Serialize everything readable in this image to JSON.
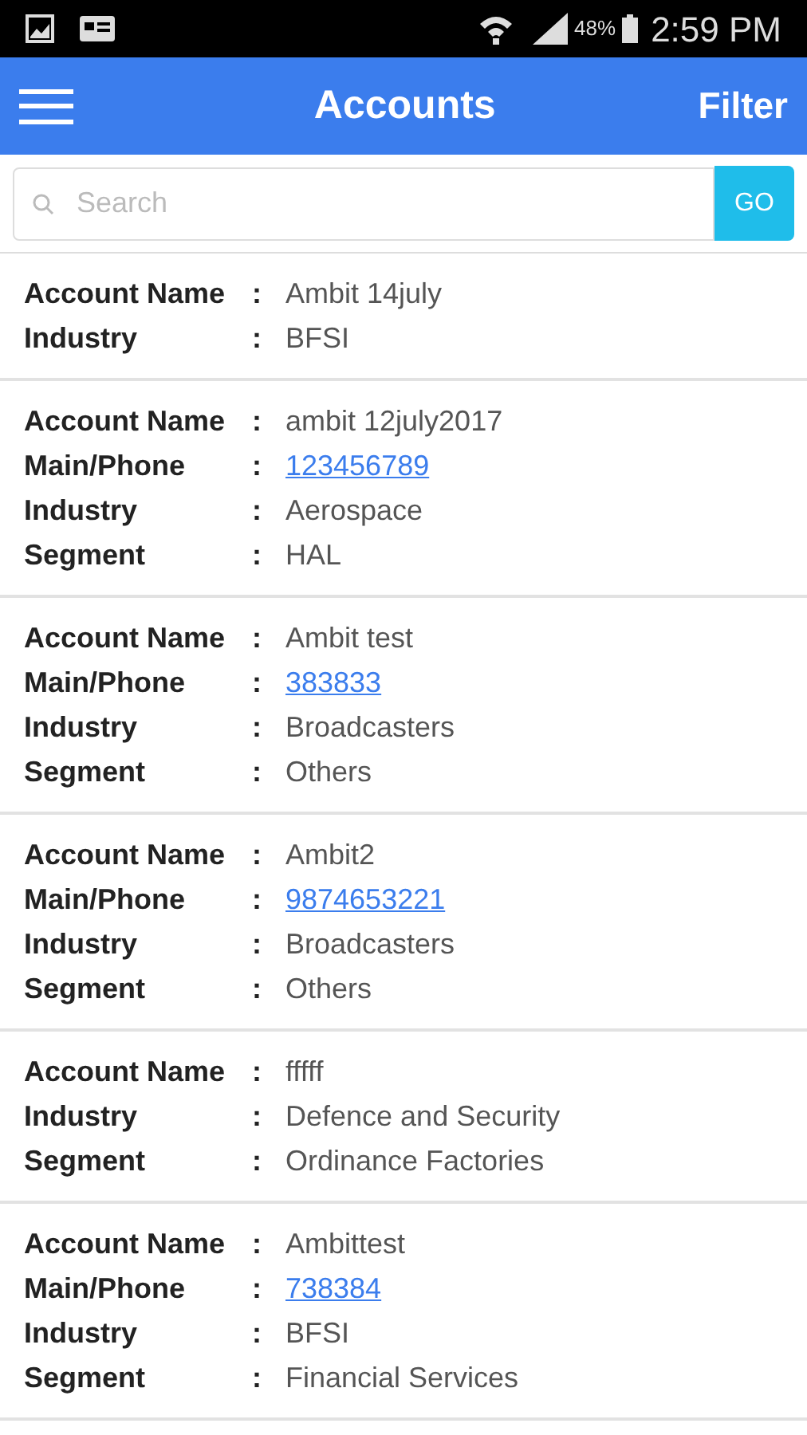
{
  "status_bar": {
    "battery": "48%",
    "time": "2:59 PM"
  },
  "header": {
    "title": "Accounts",
    "action": "Filter"
  },
  "search": {
    "placeholder": "Search",
    "button": "GO"
  },
  "accounts": [
    {
      "fields": [
        {
          "label": "Account Name",
          "separator": ":",
          "value": "Ambit 14july",
          "kind": "text"
        },
        {
          "label": "Industry",
          "separator": ":",
          "value": "BFSI",
          "kind": "text"
        }
      ]
    },
    {
      "fields": [
        {
          "label": "Account Name",
          "separator": ":",
          "value": "ambit 12july2017",
          "kind": "text"
        },
        {
          "label": "Main/Phone",
          "separator": ":",
          "value": "123456789",
          "kind": "link"
        },
        {
          "label": "Industry",
          "separator": ":",
          "value": "Aerospace",
          "kind": "text"
        },
        {
          "label": "Segment",
          "separator": ":",
          "value": "HAL",
          "kind": "text"
        }
      ]
    },
    {
      "fields": [
        {
          "label": "Account Name",
          "separator": ":",
          "value": "Ambit test",
          "kind": "text"
        },
        {
          "label": "Main/Phone",
          "separator": ":",
          "value": "383833",
          "kind": "link"
        },
        {
          "label": "Industry",
          "separator": ":",
          "value": "Broadcasters",
          "kind": "text"
        },
        {
          "label": "Segment",
          "separator": ":",
          "value": "Others",
          "kind": "text"
        }
      ]
    },
    {
      "fields": [
        {
          "label": "Account Name",
          "separator": ":",
          "value": "Ambit2",
          "kind": "text"
        },
        {
          "label": "Main/Phone",
          "separator": ":",
          "value": "9874653221",
          "kind": "link"
        },
        {
          "label": "Industry",
          "separator": ":",
          "value": "Broadcasters",
          "kind": "text"
        },
        {
          "label": "Segment",
          "separator": ":",
          "value": "Others",
          "kind": "text"
        }
      ]
    },
    {
      "fields": [
        {
          "label": "Account Name",
          "separator": ":",
          "value": "fffff",
          "kind": "text"
        },
        {
          "label": "Industry",
          "separator": ":",
          "value": "Defence and Security",
          "kind": "text"
        },
        {
          "label": "Segment",
          "separator": ":",
          "value": "Ordinance Factories",
          "kind": "text"
        }
      ]
    },
    {
      "fields": [
        {
          "label": "Account Name",
          "separator": ":",
          "value": "Ambittest",
          "kind": "text"
        },
        {
          "label": "Main/Phone",
          "separator": ":",
          "value": "738384",
          "kind": "link"
        },
        {
          "label": "Industry",
          "separator": ":",
          "value": "BFSI",
          "kind": "text"
        },
        {
          "label": "Segment",
          "separator": ":",
          "value": "Financial Services",
          "kind": "text"
        }
      ]
    }
  ]
}
